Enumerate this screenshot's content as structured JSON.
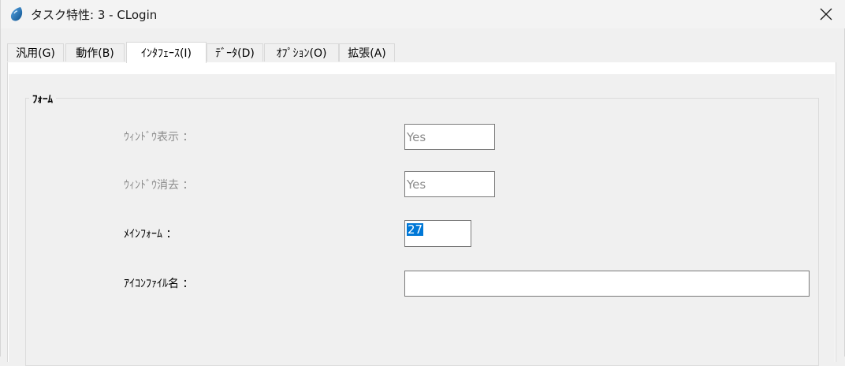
{
  "window": {
    "title": "タスク特性: 3 -   CLogin",
    "icon": "app-droplet-icon",
    "close_icon": "close-icon"
  },
  "tabs": [
    {
      "label": "汎用(G)",
      "active": false
    },
    {
      "label": "動作(B)",
      "active": false
    },
    {
      "label": "ｲﾝﾀﾌｪｰｽ(I)",
      "active": true
    },
    {
      "label": "ﾃﾞｰﾀ(D)",
      "active": false
    },
    {
      "label": "ｵﾌﾟｼｮﾝ(O)",
      "active": false
    },
    {
      "label": "拡張(A)",
      "active": false
    }
  ],
  "form_group": {
    "legend": "ﾌｫｰﾑ",
    "fields": [
      {
        "label": "ｳｨﾝﾄﾞｳ表示 ：",
        "value": "Yes",
        "enabled": false
      },
      {
        "label": "ｳｨﾝﾄﾞｳ消去 ：",
        "value": "Yes",
        "enabled": false
      },
      {
        "label": "ﾒｲﾝﾌｫｰﾑ ：",
        "value": "27",
        "enabled": true,
        "selected": true
      },
      {
        "label": "ｱｲｺﾝﾌｧｲﾙ名 ：",
        "value": "",
        "enabled": true
      }
    ]
  },
  "colors": {
    "selection": "#0078d7",
    "disabled_text": "#8c8c8c",
    "background": "#f0f0f0"
  }
}
